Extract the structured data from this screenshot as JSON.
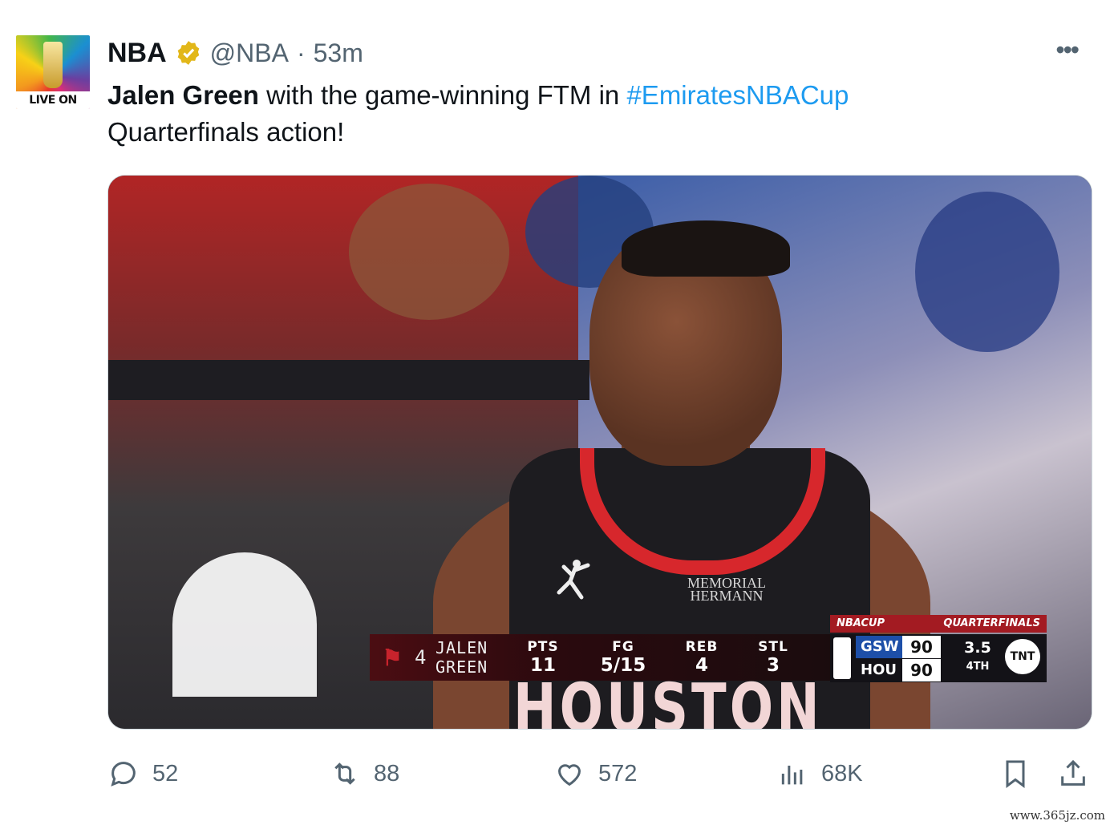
{
  "account": {
    "name": "NBA",
    "handle": "@NBA",
    "separator": "·",
    "time": "53m",
    "avatar_caption": "LIVE ON TNT"
  },
  "tweet": {
    "player": "Jalen Green",
    "text_middle": " with the game-winning FTM in ",
    "hashtag": "#EmiratesNBACup",
    "text_end": "Quarterfinals action!"
  },
  "media": {
    "jersey_text": "HOUSTON",
    "sponsor_line1": "MEMORIAL",
    "sponsor_line2": "HERMANN",
    "scoreboard": {
      "jersey_number": "4",
      "first_name": "JALEN",
      "last_name": "GREEN",
      "stats": [
        {
          "label": "PTS",
          "value": "11"
        },
        {
          "label": "FG",
          "value": "5/15"
        },
        {
          "label": "REB",
          "value": "4"
        },
        {
          "label": "STL",
          "value": "3"
        }
      ],
      "banner_left": "NBACUP",
      "banner_right": "QUARTERFINALS",
      "teams": [
        {
          "abbr": "GSW",
          "score": "90"
        },
        {
          "abbr": "HOU",
          "score": "90"
        }
      ],
      "clock": "3.5",
      "period": "4TH",
      "network": "TNT"
    }
  },
  "actions": {
    "replies": "52",
    "reposts": "88",
    "likes": "572",
    "views": "68K"
  },
  "colors": {
    "accent": "#1d9bf0",
    "verified": "#e2b719",
    "muted": "#536471",
    "rockets_red": "#c8232c"
  },
  "watermark": "www.365jz.com"
}
